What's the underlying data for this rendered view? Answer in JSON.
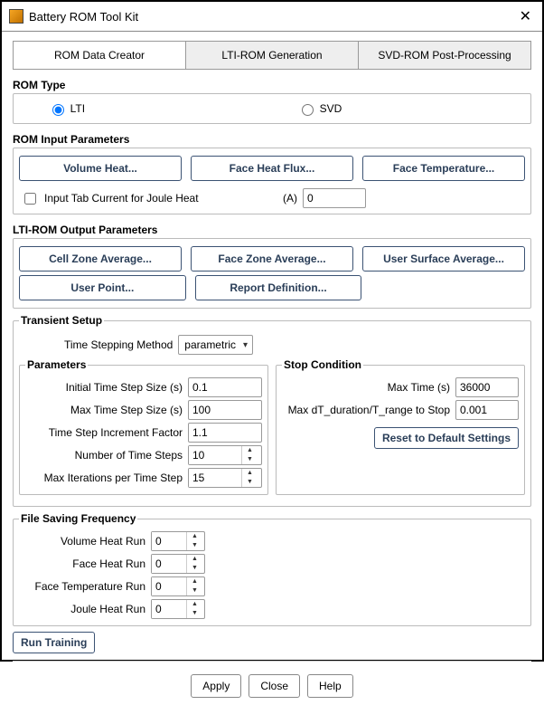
{
  "window": {
    "title": "Battery ROM Tool Kit"
  },
  "tabs": {
    "items": [
      {
        "label": "ROM Data Creator",
        "active": true
      },
      {
        "label": "LTI-ROM Generation",
        "active": false
      },
      {
        "label": "SVD-ROM Post-Processing",
        "active": false
      }
    ]
  },
  "rom_type": {
    "title": "ROM Type",
    "options": {
      "lti": "LTI",
      "svd": "SVD"
    },
    "selected": "lti"
  },
  "rom_input": {
    "title": "ROM Input Parameters",
    "buttons": {
      "volume_heat": "Volume Heat...",
      "face_heat_flux": "Face Heat Flux...",
      "face_temperature": "Face Temperature..."
    },
    "joule_checkbox_label": "Input Tab Current for Joule Heat",
    "joule_unit": "(A)",
    "joule_value": "0"
  },
  "lti_output": {
    "title": "LTI-ROM Output Parameters",
    "buttons": {
      "cell_zone_avg": "Cell Zone Average...",
      "face_zone_avg": "Face Zone Average...",
      "user_surface_avg": "User Surface Average...",
      "user_point": "User Point...",
      "report_def": "Report Definition..."
    }
  },
  "transient": {
    "title": "Transient Setup",
    "time_stepping_label": "Time Stepping Method",
    "time_stepping_value": "parametric",
    "parameters_title": "Parameters",
    "params": {
      "initial_step_label": "Initial Time Step Size (s)",
      "initial_step_value": "0.1",
      "max_step_label": "Max Time Step Size (s)",
      "max_step_value": "100",
      "increment_label": "Time Step Increment Factor",
      "increment_value": "1.1",
      "num_steps_label": "Number of Time Steps",
      "num_steps_value": "10",
      "max_iter_label": "Max Iterations per Time Step",
      "max_iter_value": "15"
    },
    "stop_title": "Stop Condition",
    "stop": {
      "max_time_label": "Max Time (s)",
      "max_time_value": "36000",
      "dt_label": "Max dT_duration/T_range to Stop",
      "dt_value": "0.001"
    },
    "reset_button": "Reset to Default Settings"
  },
  "file_saving": {
    "title": "File Saving Frequency",
    "fields": {
      "volume_heat_label": "Volume Heat Run",
      "volume_heat_value": "0",
      "face_heat_label": "Face Heat Run",
      "face_heat_value": "0",
      "face_temp_label": "Face Temperature Run",
      "face_temp_value": "0",
      "joule_heat_label": "Joule Heat Run",
      "joule_heat_value": "0"
    }
  },
  "run_button": "Run Training",
  "footer": {
    "apply": "Apply",
    "close": "Close",
    "help": "Help"
  }
}
